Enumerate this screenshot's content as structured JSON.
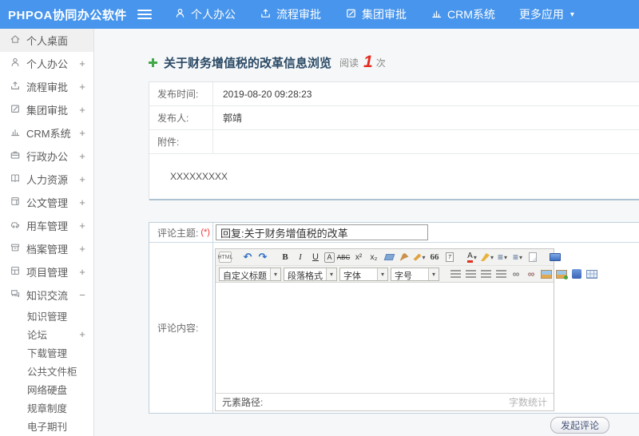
{
  "topbar": {
    "logo": "PHPOA协同办公软件",
    "caret": "▾",
    "menu": [
      {
        "label": "个人办公",
        "icon": "person-icon"
      },
      {
        "label": "流程审批",
        "icon": "flow-approval-icon"
      },
      {
        "label": "集团审批",
        "icon": "edit-approval-icon"
      },
      {
        "label": "CRM系统",
        "icon": "bar-chart-icon"
      },
      {
        "label": "更多应用",
        "icon": "caret-down-icon"
      }
    ]
  },
  "sidebar": {
    "items": [
      {
        "label": "个人桌面",
        "expand": "",
        "icon": "home-icon",
        "active": true
      },
      {
        "label": "个人办公",
        "expand": "+",
        "icon": "person-icon"
      },
      {
        "label": "流程审批",
        "expand": "+",
        "icon": "flow-approval-icon"
      },
      {
        "label": "集团审批",
        "expand": "+",
        "icon": "edit-approval-icon"
      },
      {
        "label": "CRM系统",
        "expand": "+",
        "icon": "bar-chart-icon"
      },
      {
        "label": "行政办公",
        "expand": "+",
        "icon": "briefcase-icon"
      },
      {
        "label": "人力资源",
        "expand": "+",
        "icon": "book-icon"
      },
      {
        "label": "公文管理",
        "expand": "+",
        "icon": "document-icon"
      },
      {
        "label": "用车管理",
        "expand": "+",
        "icon": "car-icon"
      },
      {
        "label": "档案管理",
        "expand": "+",
        "icon": "archive-icon"
      },
      {
        "label": "项目管理",
        "expand": "+",
        "icon": "project-icon"
      },
      {
        "label": "知识交流",
        "expand": "−",
        "icon": "chat-icon"
      }
    ],
    "subitems": [
      {
        "label": "知识管理",
        "expand": ""
      },
      {
        "label": "论坛",
        "expand": "+"
      },
      {
        "label": "下载管理",
        "expand": ""
      },
      {
        "label": "公共文件柜",
        "expand": ""
      },
      {
        "label": "网络硬盘",
        "expand": ""
      },
      {
        "label": "规章制度",
        "expand": ""
      },
      {
        "label": "电子期刊",
        "expand": ""
      }
    ]
  },
  "article": {
    "title": "关于财务增值税的改革信息浏览",
    "read_label": "阅读",
    "read_count": "1",
    "read_unit": "次",
    "rows": [
      {
        "label": "发布时间:",
        "value": "2019-08-20 09:28:23"
      },
      {
        "label": "发布人:",
        "value": "郭靖"
      },
      {
        "label": "附件:",
        "value": ""
      }
    ],
    "content": "XXXXXXXXX"
  },
  "comment": {
    "subject_label": "评论主题:",
    "required": "(*)",
    "subject_value": "回复:关于财务增值税的改革",
    "content_label": "评论内容:",
    "submit": "发起评论"
  },
  "editor": {
    "glyphs": {
      "html": "HTML",
      "undo": "↶",
      "redo": "↷",
      "bold": "B",
      "italic": "I",
      "underline": "U",
      "boxed_a": "A",
      "strike": "ABC",
      "sup": "x²",
      "sub": "x₂",
      "quote": "66",
      "paste": "T",
      "font_color": "A",
      "olist": "≡",
      "ulist": "≡",
      "link": "∞",
      "unlink": "∞",
      "caret": "▾"
    },
    "dropdowns": [
      {
        "label": "自定义标题"
      },
      {
        "label": "段落格式"
      },
      {
        "label": "字体"
      },
      {
        "label": "字号"
      }
    ],
    "status_left": "元素路径:",
    "status_right": "字数统计"
  }
}
